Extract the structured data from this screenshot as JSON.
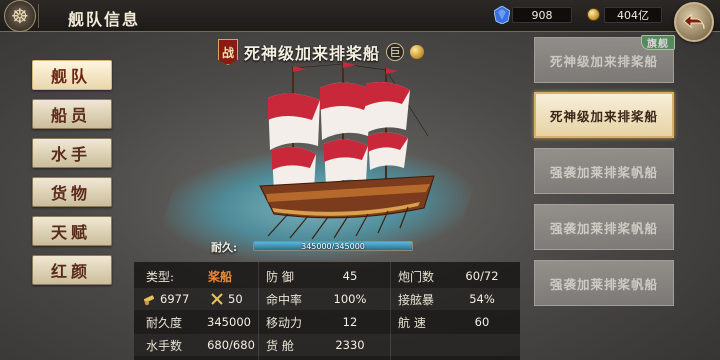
{
  "header": {
    "title": "舰队信息",
    "gems": "908",
    "coins": "404亿"
  },
  "tabs": [
    {
      "label": "舰队",
      "active": true
    },
    {
      "label": "船员",
      "active": false
    },
    {
      "label": "水手",
      "active": false
    },
    {
      "label": "货物",
      "active": false
    },
    {
      "label": "天赋",
      "active": false
    },
    {
      "label": "红颜",
      "active": false
    }
  ],
  "ship": {
    "battle_badge": "战",
    "name": "死神级加来排桨船",
    "size_badge": "巨",
    "durability_label": "耐久:",
    "durability_text": "345000/345000",
    "durability_fraction": 1.0
  },
  "stats": [
    [
      {
        "label": "类型:",
        "value": "桨船"
      },
      {
        "label": "防 御",
        "value": "45"
      },
      {
        "label": "炮门数",
        "value": "60/72"
      }
    ],
    [
      {
        "icon": "cannon-icon",
        "value": "6977"
      },
      {
        "icon": "crossed-swords-icon",
        "value": "50"
      },
      {
        "label": "命中率",
        "value": "100%"
      },
      {
        "label": "接舷暴",
        "value": "54%"
      }
    ],
    [
      {
        "label": "耐久度",
        "value": "345000"
      },
      {
        "label": "移动力",
        "value": "12"
      },
      {
        "label": "航 速",
        "value": "60"
      }
    ],
    [
      {
        "label": "水手数",
        "value": "680/680"
      },
      {
        "label": "货 舱",
        "value": "2330"
      }
    ]
  ],
  "fleet": [
    {
      "name": "死神级加来排桨船",
      "badge": "旗舰",
      "selected": false
    },
    {
      "name": "死神级加来排桨船",
      "badge": "",
      "selected": true
    },
    {
      "name": "强袭加莱排桨帆船",
      "badge": "",
      "selected": false
    },
    {
      "name": "强袭加莱排桨帆船",
      "badge": "",
      "selected": false
    },
    {
      "name": "强袭加莱排桨帆船",
      "badge": "",
      "selected": false
    }
  ],
  "colors": {
    "accent_orange": "#ee8a35",
    "durability_blue": "#5ab8d6",
    "sail_red": "#c8283a",
    "flag_green": "#5ea26a"
  }
}
